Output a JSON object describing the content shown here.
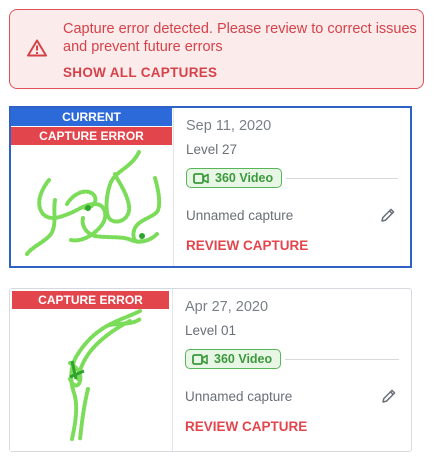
{
  "alert": {
    "message": "Capture error detected. Please review to correct issues and prevent future errors",
    "link_label": "SHOW ALL CAPTURES",
    "icon": "warning-triangle-icon"
  },
  "captures": [
    {
      "current_badge": "CURRENT",
      "error_badge": "CAPTURE ERROR",
      "date": "Sep 11, 2020",
      "level": "Level 27",
      "type_label": "360 Video",
      "name": "Unnamed capture",
      "review_label": "REVIEW CAPTURE"
    },
    {
      "error_badge": "CAPTURE ERROR",
      "date": "Apr 27, 2020",
      "level": "Level 01",
      "type_label": "360 Video",
      "name": "Unnamed capture",
      "review_label": "REVIEW CAPTURE"
    }
  ],
  "colors": {
    "error_red": "#e2464c",
    "current_blue": "#2c6ad9",
    "video_green": "#58b558"
  }
}
